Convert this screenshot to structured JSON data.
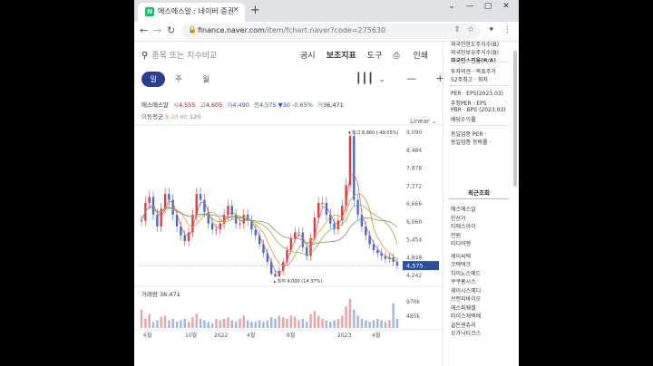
{
  "browser": {
    "tab_title": "에스에스알 : 네이버 증권",
    "tab_close": "×",
    "new_tab": "+",
    "url_host": "finance.naver.com",
    "url_path": "/item/fchart.naver?code=275630",
    "window_controls": [
      "⌄",
      "—",
      "▢",
      "✕"
    ]
  },
  "page": {
    "search_placeholder": "종목 또는 지수비교",
    "tools": [
      "공시",
      "보조지표",
      "도구"
    ],
    "print_label": "인쇄",
    "periods": [
      "일",
      "주",
      "월"
    ],
    "active_period": "일",
    "info": {
      "name": "에스에스알",
      "open_lbl": "시",
      "open": "4,555",
      "high_lbl": "고",
      "high": "4,605",
      "low_lbl": "저",
      "low": "4,490",
      "close_lbl": "종",
      "close": "4,575",
      "change": "▼30 -0.65%",
      "vol_lbl": "거",
      "volume": "36,471"
    },
    "ma": {
      "label": "이동평균",
      "p5": "5",
      "p20": "20",
      "p60": "60",
      "p120": "120"
    },
    "scale_mode": "Linear",
    "volume_label": "거래량 36,471"
  },
  "chart_data": {
    "type": "candlestick",
    "price_ticks": [
      "9,090",
      "8,484",
      "7,878",
      "7,272",
      "6,666",
      "6,060",
      "5,454",
      "4,848",
      "4,242"
    ],
    "current_price": "4,575",
    "high_annotation": "최고 8,960 (-49.05%)",
    "low_annotation": "최저 4,000 (14.37%)",
    "volume_ticks": [
      "970k",
      "485k"
    ],
    "x_labels": [
      "6월",
      "10월",
      "2022",
      "4월",
      "8월",
      "2023",
      "4월"
    ],
    "close_series": [
      6100,
      6700,
      6900,
      6300,
      5900,
      6500,
      7000,
      6800,
      6300,
      5900,
      5600,
      5400,
      5700,
      6300,
      7000,
      6800,
      6400,
      6000,
      5800,
      5800,
      6000,
      6300,
      6600,
      6300,
      6000,
      6000,
      6300,
      6100,
      5800,
      5600,
      5300,
      5000,
      4700,
      4300,
      4200,
      4400,
      4700,
      5100,
      5500,
      5700,
      5700,
      5200,
      4900,
      5500,
      6200,
      6700,
      6700,
      6300,
      6000,
      5800,
      6100,
      6600,
      7300,
      8960,
      6800,
      6300,
      5900,
      5600,
      5300,
      5100,
      5000,
      4900,
      4800,
      4850,
      4700,
      4575
    ],
    "volume_series": [
      60,
      30,
      45,
      20,
      25,
      35,
      40,
      25,
      30,
      20,
      25,
      30,
      20,
      35,
      45,
      30,
      25,
      20,
      15,
      30,
      25,
      30,
      35,
      25,
      20,
      30,
      40,
      25,
      20,
      20,
      25,
      20,
      25,
      35,
      30,
      40,
      35,
      30,
      40,
      35,
      25,
      30,
      20,
      45,
      55,
      40,
      30,
      25,
      20,
      25,
      30,
      40,
      70,
      95,
      60,
      40,
      30,
      25,
      20,
      25,
      30,
      25,
      20,
      25,
      80,
      30
    ]
  },
  "sidebar": {
    "top_items": [
      "외국인한도주식수(B)",
      "외국인보유주식수(B)",
      "외국인소진율(B/A)"
    ],
    "mid_items": [
      "투자의견 · 목표주가",
      "52주최고 · 최저"
    ],
    "per_items": [
      "PER · EPS(2023.03)",
      "추정PER · EPS",
      "PBR · BPS (2023.03)",
      "배당수익률"
    ],
    "sector_items": [
      "동일업종 PER ·",
      "동일업종 등락률 ·"
    ],
    "recent_header": "최근조회",
    "recent_items": [
      "에스에스알",
      "인산가",
      "티에스아이",
      "전원",
      "미디어젠",
      "케이씨텍",
      "코텍텍크",
      "차이노스메드",
      "쿠쿠홈시스",
      "제이시스메디",
      "브랜지바이오",
      "에스피웨셀",
      "마이스캐텍에",
      "골든센츄리",
      "오가닉티코스"
    ]
  }
}
